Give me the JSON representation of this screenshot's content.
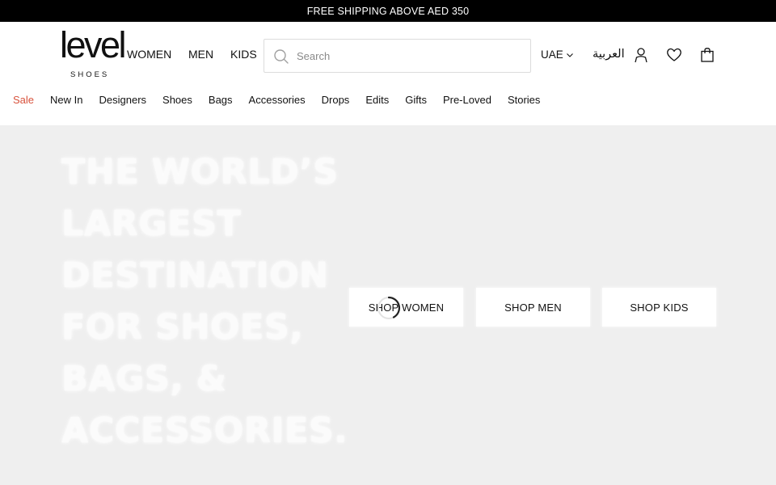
{
  "promo": {
    "text": "FREE SHIPPING ABOVE AED 350"
  },
  "logo": {
    "word": "level",
    "sub": "SHOES"
  },
  "gender_nav": [
    {
      "label": "WOMEN",
      "active": true
    },
    {
      "label": "MEN",
      "active": false
    },
    {
      "label": "KIDS",
      "active": false
    }
  ],
  "search": {
    "placeholder": "Search",
    "value": ""
  },
  "region": {
    "label": "UAE"
  },
  "language": {
    "label": "العربية"
  },
  "icons": {
    "search": "search-icon",
    "region_chevron": "chevron-down-icon",
    "account": "user-icon",
    "wishlist": "heart-icon",
    "bag": "shopping-bag-icon",
    "loading": "spinner-icon"
  },
  "categories": [
    "Sale",
    "New In",
    "Designers",
    "Shoes",
    "Bags",
    "Accessories",
    "Drops",
    "Edits",
    "Gifts",
    "Pre-Loved",
    "Stories"
  ],
  "hero": {
    "heading_lines": [
      "THE WORLD’S",
      "LARGEST",
      "DESTINATION",
      "FOR SHOES,",
      "BAGS, &",
      "ACCESSORIES."
    ],
    "buttons": [
      "SHOP WOMEN",
      "SHOP MEN",
      "SHOP KIDS"
    ]
  },
  "colors": {
    "promo_bg": "#000000",
    "sale": "#d8523c",
    "hero_bg": "#efefef"
  }
}
